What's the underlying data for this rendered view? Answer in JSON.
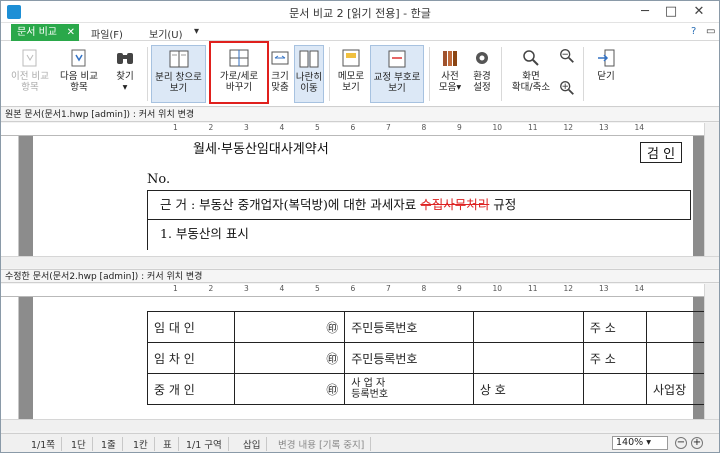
{
  "window": {
    "title": "문서 비교 2 [읽기 전용] - 한글",
    "min": "─",
    "max": "□",
    "close": "✕"
  },
  "menubar": {
    "active_tab": "문서 비교",
    "tab_close": "✕",
    "items": [
      "파일(F)",
      "보기(U)"
    ],
    "overflow": "▾",
    "help": "?",
    "restore": "▭"
  },
  "toolbar": {
    "prev": "이전 비교|항목",
    "next": "다음 비교|항목",
    "find": "찾기",
    "find_arrow": "▾",
    "split": "분리 창으로|보기",
    "orient": "가로/세로|바꾸기",
    "fit": "크기|맞춤",
    "parallel": "나란히|이동",
    "memo": "메모로|보기",
    "proofmark": "교정 부호로|보기",
    "dictionary": "사전|모음",
    "dict_arrow": "▾",
    "env": "환경|설정",
    "zoom": "화면|확대/축소",
    "close": "닫기"
  },
  "pane1": {
    "status": "원본 문서(문서1.hwp [admin]) : 커서 위치 변경",
    "title": "월세·부동산임대사계약서",
    "box": "검  인",
    "no": "No.",
    "line1a": "근  거 : 부동산 중개업자(복덕방)에  대한 과세자료 ",
    "line1_strike": "수집사무처리",
    "line1b": " 규정",
    "line2": "1. 부동산의 표시"
  },
  "pane2": {
    "status": "수정한 문서(문서2.hwp [admin]) : 커서 위치 변경",
    "rows": [
      {
        "label": "임  대  인",
        "seal": "㊞",
        "reg": "주민등록번호",
        "addr": "주  소"
      },
      {
        "label": "임  차  인",
        "seal": "㊞",
        "reg": "주민등록번호",
        "addr": "주  소"
      },
      {
        "label": "중  개  인",
        "seal": "㊞",
        "reg": "사 업 자\n등록번호",
        "trade": "상 호",
        "office": "사업장"
      }
    ]
  },
  "ruler_numbers": [
    "1",
    "2",
    "3",
    "4",
    "5",
    "6",
    "7",
    "8",
    "9",
    "10",
    "11",
    "12",
    "13",
    "14"
  ],
  "statusbar": {
    "page": "1/1쪽",
    "section": "1단",
    "line": "1줄",
    "col": "1칸",
    "kind": "표",
    "zone": "1/1 구역",
    "mode": "삽입",
    "changes": "변경 내용 [기록 중지]",
    "zoom": "140%",
    "zoom_arrow": "▾",
    "zoom_out": "−",
    "zoom_in": "+"
  }
}
